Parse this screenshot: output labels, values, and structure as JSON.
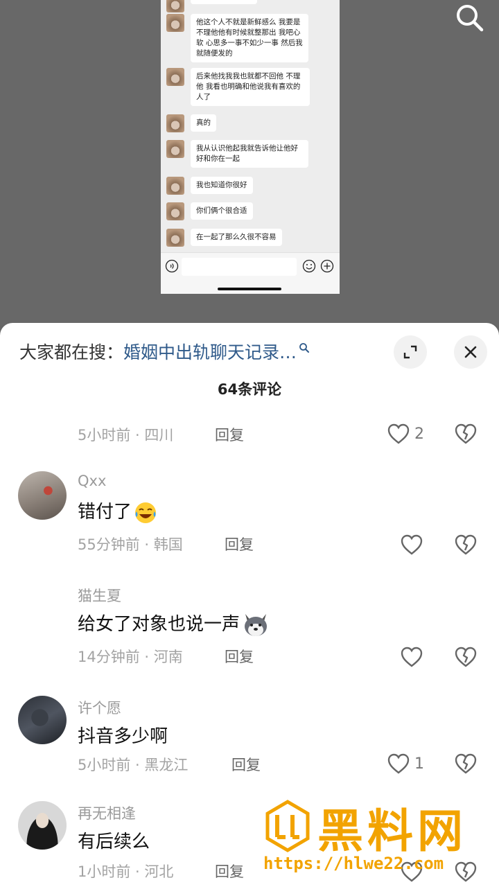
{
  "chat": {
    "messages": [
      "他这个人不就是新鲜感么 我要是不理他他有时候就整那出 我吧心软 心思多一事不如少一事 然后我就随便发的",
      "后来他找我我也就都不回他 不理他 我看也明确和他说我有喜欢的人了",
      "真的",
      "我从认识他起我就告诉他让他好好和你在一起",
      "我也知道你很好",
      "你们俩个很合适",
      "在一起了那么久很不容易"
    ]
  },
  "search_bar": {
    "label": "大家都在搜：",
    "term": "婚姻中出轨聊天记录…"
  },
  "comment_count": "64条评论",
  "comments": [
    {
      "user": "",
      "text": "",
      "time": "5小时前",
      "location": "四川",
      "reply": "回复",
      "likes": "2"
    },
    {
      "user": "Qxx",
      "text": "错付了",
      "emoji": "crying-laughing-emoji",
      "time": "55分钟前",
      "location": "韩国",
      "reply": "回复",
      "likes": ""
    },
    {
      "user": "猫生夏",
      "text": "给女了对象也说一声",
      "emoji": "husky-dog-emoji",
      "time": "14分钟前",
      "location": "河南",
      "reply": "回复",
      "likes": ""
    },
    {
      "user": "许个愿",
      "text": "抖音多少啊",
      "time": "5小时前",
      "location": "黑龙江",
      "reply": "回复",
      "likes": "1"
    },
    {
      "user": "再无相逢",
      "text": "有后续么",
      "time": "1小时前",
      "location": "河北",
      "reply": "回复",
      "likes": ""
    }
  ],
  "watermark": {
    "title": "黑料网",
    "url": "https://hlwe22.com"
  },
  "icons": {
    "search": "search-icon",
    "expand": "expand-icon",
    "close": "close-icon",
    "like": "heart-icon",
    "dislike": "broken-heart-icon",
    "voice": "voice-icon",
    "emoji": "smiley-icon",
    "plus": "plus-icon"
  },
  "colors": {
    "search_term": "#2f5a8a",
    "watermark": "#f2a300"
  }
}
